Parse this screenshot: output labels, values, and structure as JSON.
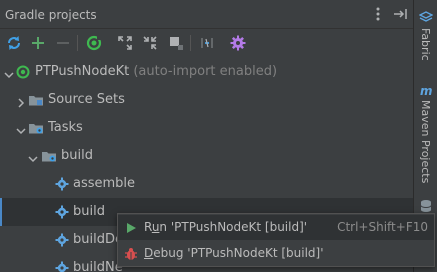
{
  "panel": {
    "title": "Gradle projects",
    "menu_icon": "more-vertical-icon",
    "hide_icon": "hide-panel-icon"
  },
  "toolbar": {
    "buttons": [
      {
        "name": "refresh",
        "icon": "refresh-icon"
      },
      {
        "name": "add",
        "icon": "plus-icon"
      },
      {
        "name": "remove",
        "icon": "minus-icon"
      },
      {
        "name": "execute-task",
        "icon": "gradle-run-icon"
      },
      {
        "name": "expand-all",
        "icon": "expand-all-icon"
      },
      {
        "name": "collapse-all",
        "icon": "collapse-all-icon"
      },
      {
        "name": "toggle-offline",
        "icon": "offline-icon"
      },
      {
        "name": "link-project",
        "icon": "link-icon"
      },
      {
        "name": "settings",
        "icon": "gear-icon"
      }
    ]
  },
  "tree": {
    "project": {
      "label": "PTPushNodeKt",
      "suffix": "(auto-import enabled)"
    },
    "source_sets": {
      "label": "Source Sets"
    },
    "tasks": {
      "label": "Tasks"
    },
    "build_group": {
      "label": "build"
    },
    "items": [
      {
        "label": "assemble"
      },
      {
        "label": "build"
      },
      {
        "label": "buildDe"
      },
      {
        "label": "buildNe"
      }
    ]
  },
  "sidebar": {
    "fabric": "Fabric",
    "maven": "Maven Projects"
  },
  "context_menu": {
    "run": {
      "prefix": "R",
      "mnemonic": "u",
      "rest": "n 'PTPushNodeKt [build]'",
      "shortcut": "Ctrl+Shift+F10"
    },
    "debug": {
      "mnemonic": "D",
      "rest": "ebug 'PTPushNodeKt [build]'"
    }
  },
  "colors": {
    "accent_green": "#59a869",
    "accent_blue": "#40a0e6",
    "gradle_green": "#3fb950",
    "gear_purple": "#b47be8",
    "folder": "#87939a",
    "debug_red": "#d94f4f"
  }
}
